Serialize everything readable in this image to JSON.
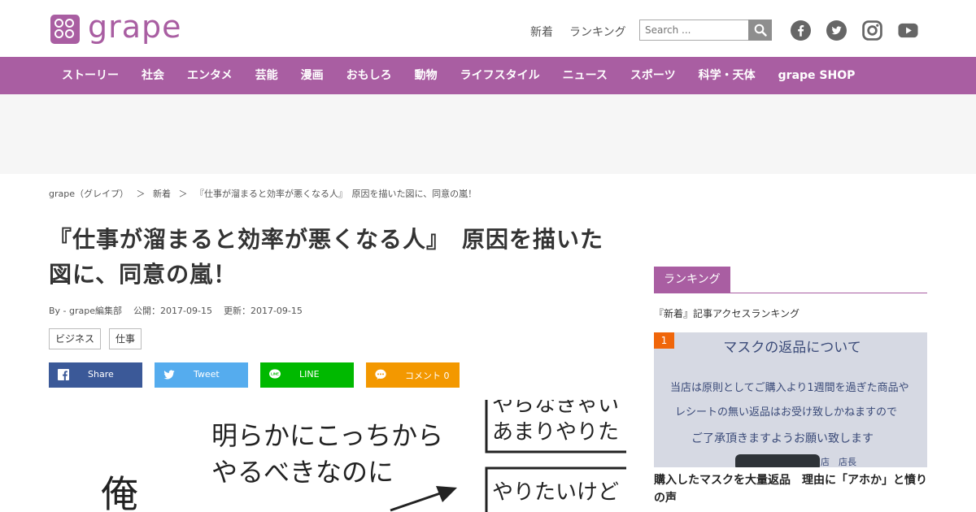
{
  "header": {
    "logo_text": "grape",
    "top_links": [
      "新着",
      "ランキング"
    ],
    "search_placeholder": "Search ...",
    "brand_color": "#a95ea2",
    "social_icons": [
      "facebook-icon",
      "twitter-icon",
      "instagram-icon",
      "youtube-icon"
    ]
  },
  "nav": {
    "items": [
      "ストーリー",
      "社会",
      "エンタメ",
      "芸能",
      "漫画",
      "おもしろ",
      "動物",
      "ライフスタイル",
      "ニュース",
      "スポーツ",
      "科学・天体",
      "grape SHOP"
    ]
  },
  "breadcrumb": {
    "home": "grape（グレイプ）",
    "sep1": "＞",
    "section": "新着",
    "sep2": "＞",
    "current": "『仕事が溜まると効率が悪くなる人』　原因を描いた図に、同意の嵐！"
  },
  "article": {
    "title": "『仕事が溜まると効率が悪くなる人』　原因を描いた図に、同意の嵐！",
    "author": "By - grape編集部",
    "published": "公開：2017-09-15",
    "updated": "更新：2017-09-15",
    "tags": [
      "ビジネス",
      "仕事"
    ],
    "share": {
      "facebook": "Share",
      "twitter": "Tweet",
      "line": "LINE",
      "comment": "コメント 0"
    },
    "image_text": {
      "main_line1": "明らかにこっちから",
      "main_line2": "やるべきなのに",
      "left_char": "俺",
      "box1_line1": "やらなきゃい",
      "box1_line2": "あまりやりた",
      "box2_line1": "やりたいけど"
    }
  },
  "sidebar": {
    "tab": "ランキング",
    "subtitle": "『新着』記事アクセスランキング",
    "rank_number": "1",
    "rank_badge_color": "#f0660a",
    "rank_image_text": {
      "heading": "マスクの返品について",
      "line1": "当店は原則としてご購入より1週間を過ぎた商品や",
      "line2": "レシートの無い返品はお受け致しかねますので",
      "line3": "ご了承頂きますようお願い致します",
      "sign": "店　店長"
    },
    "rank_title": "購入したマスクを大量返品　理由に「アホか」と憤りの声"
  }
}
